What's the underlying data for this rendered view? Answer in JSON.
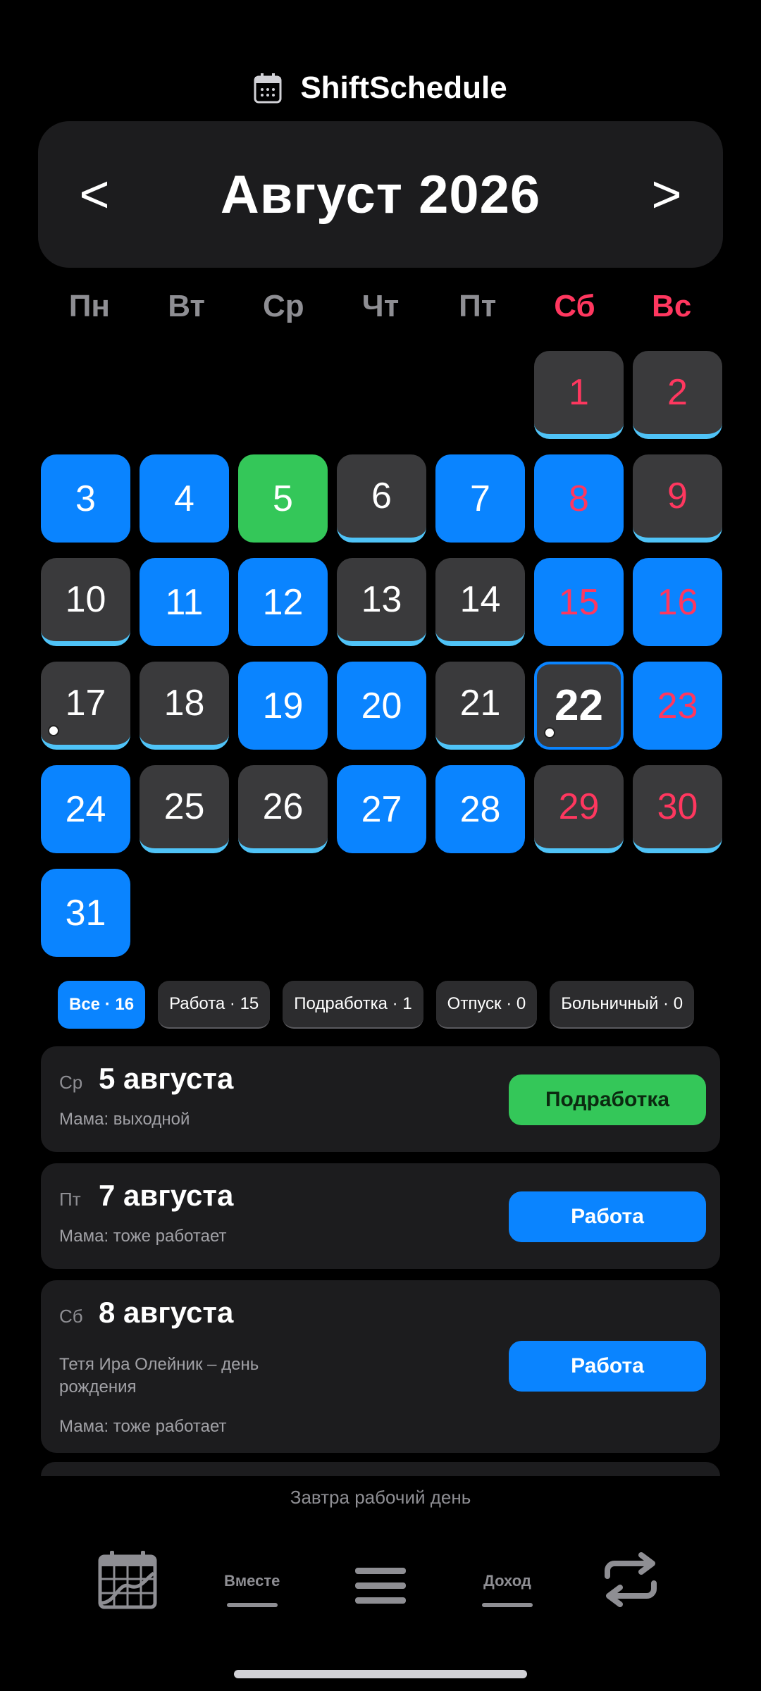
{
  "app": {
    "title": "ShiftSchedule",
    "icon": "calendar-icon"
  },
  "month": {
    "title": "Август 2026",
    "prev": "<",
    "next": ">"
  },
  "weekdays": [
    "Пн",
    "Вт",
    "Ср",
    "Чт",
    "Пт",
    "Сб",
    "Вс"
  ],
  "days": [
    {
      "d": "1",
      "t": "off",
      "w": true
    },
    {
      "d": "2",
      "t": "off",
      "w": true
    },
    {
      "d": "3",
      "t": "work"
    },
    {
      "d": "4",
      "t": "work"
    },
    {
      "d": "5",
      "t": "side"
    },
    {
      "d": "6",
      "t": "off"
    },
    {
      "d": "7",
      "t": "work"
    },
    {
      "d": "8",
      "t": "work",
      "w": true
    },
    {
      "d": "9",
      "t": "off",
      "w": true
    },
    {
      "d": "10",
      "t": "off"
    },
    {
      "d": "11",
      "t": "work"
    },
    {
      "d": "12",
      "t": "work"
    },
    {
      "d": "13",
      "t": "off"
    },
    {
      "d": "14",
      "t": "off"
    },
    {
      "d": "15",
      "t": "work",
      "w": true
    },
    {
      "d": "16",
      "t": "work",
      "w": true
    },
    {
      "d": "17",
      "t": "off",
      "dot": true
    },
    {
      "d": "18",
      "t": "off"
    },
    {
      "d": "19",
      "t": "work"
    },
    {
      "d": "20",
      "t": "work"
    },
    {
      "d": "21",
      "t": "off"
    },
    {
      "d": "22",
      "t": "today",
      "dot": true
    },
    {
      "d": "23",
      "t": "work",
      "w": true
    },
    {
      "d": "24",
      "t": "work"
    },
    {
      "d": "25",
      "t": "off"
    },
    {
      "d": "26",
      "t": "off"
    },
    {
      "d": "27",
      "t": "work"
    },
    {
      "d": "28",
      "t": "work"
    },
    {
      "d": "29",
      "t": "off",
      "w": true
    },
    {
      "d": "30",
      "t": "off",
      "w": true
    },
    {
      "d": "31",
      "t": "work"
    }
  ],
  "filters": [
    "Все · 16",
    "Работа · 15",
    "Подработка · 1",
    "Отпуск · 0",
    "Больничный · 0"
  ],
  "events": [
    {
      "dow": "Ср",
      "date": "5 августа",
      "notes": [
        "Мама: выходной"
      ],
      "badge": "Подработка",
      "color": "green"
    },
    {
      "dow": "Пт",
      "date": "7 августа",
      "notes": [
        "Мама: тоже работает"
      ],
      "badge": "Работа",
      "color": "blue"
    },
    {
      "dow": "Сб",
      "date": "8 августа",
      "notes": [
        "Тетя Ира Олейник – день рождения",
        "Мама: тоже работает"
      ],
      "badge": "Работа",
      "color": "blue"
    }
  ],
  "status": "Завтра рабочий день",
  "nav": {
    "together": "Вместе",
    "income": "Доход"
  },
  "colors": {
    "work": "#0a84ff",
    "side": "#34c759",
    "off": "#3a3a3c",
    "weekend": "#ff375f",
    "underline": "#4fc3f7"
  }
}
